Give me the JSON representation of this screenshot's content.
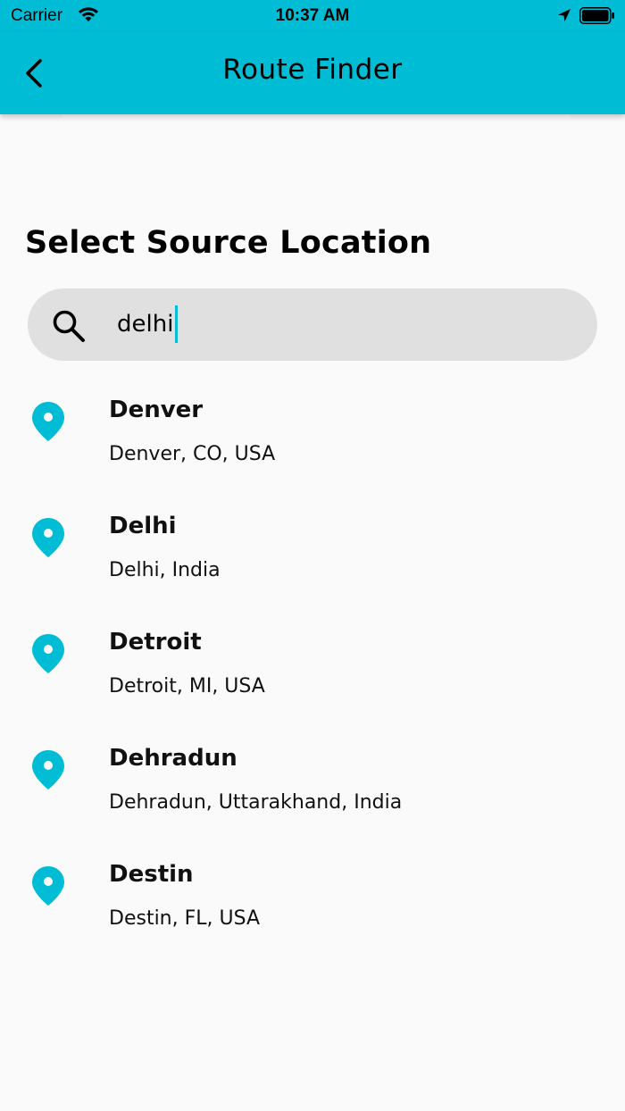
{
  "status_bar": {
    "carrier": "Carrier",
    "time": "10:37 AM",
    "icons": [
      "wifi-icon",
      "location-arrow-icon",
      "battery-icon"
    ]
  },
  "app_bar": {
    "title": "Route Finder",
    "back_icon": "chevron-left-icon",
    "color": "#00bcd4"
  },
  "section_title": "Select Source Location",
  "search": {
    "icon": "search-icon",
    "value": "delhi",
    "placeholder": ""
  },
  "results": [
    {
      "name": "Denver",
      "address": "Denver, CO, USA",
      "icon": "map-pin-icon"
    },
    {
      "name": "Delhi",
      "address": "Delhi, India",
      "icon": "map-pin-icon"
    },
    {
      "name": "Detroit",
      "address": "Detroit, MI, USA",
      "icon": "map-pin-icon"
    },
    {
      "name": "Dehradun",
      "address": "Dehradun, Uttarakhand, India",
      "icon": "map-pin-icon"
    },
    {
      "name": "Destin",
      "address": "Destin, FL, USA",
      "icon": "map-pin-icon"
    }
  ],
  "colors": {
    "accent": "#00bcd4",
    "background": "#fafafa",
    "search_bg": "#e0e0e0"
  }
}
